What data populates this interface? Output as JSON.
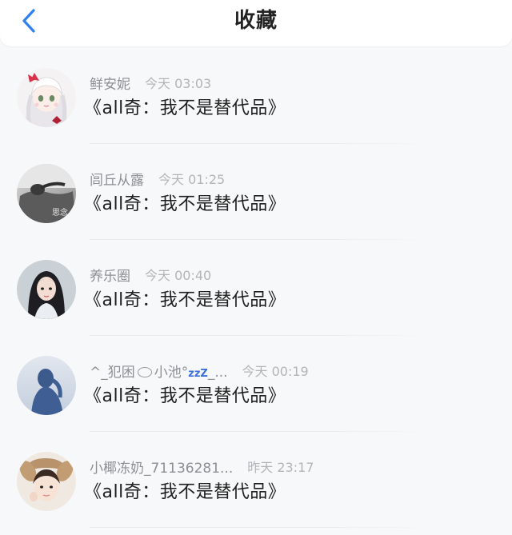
{
  "header": {
    "title": "收藏",
    "back_icon": "chevron-left-icon",
    "back_color": "#2f80ed"
  },
  "favorites": [
    {
      "name": "鲜安妮",
      "time": "今天 03:03",
      "title": "《all奇：我不是替代品》",
      "avatar_icon": "anime-girl-avatar"
    },
    {
      "name": "闾丘从露",
      "time": "今天 01:25",
      "title": "《all奇：我不是替代品》",
      "avatar_icon": "grayscale-photo-avatar"
    },
    {
      "name": "养乐圈",
      "time": "今天 00:40",
      "title": "《all奇：我不是替代品》",
      "avatar_icon": "girl-portrait-avatar"
    },
    {
      "name_prefix": "^_犯困",
      "name_mid": "小池°",
      "name_zzz": "zzZ",
      "name_suffix": "_...",
      "time": "今天 00:19",
      "title": "《all奇：我不是替代品》",
      "avatar_icon": "blue-silhouette-avatar"
    },
    {
      "name": "小椰冻奶_71136281...",
      "time": "昨天 23:17",
      "title": "《all奇：我不是替代品》",
      "avatar_icon": "bunny-hat-girl-avatar"
    }
  ]
}
